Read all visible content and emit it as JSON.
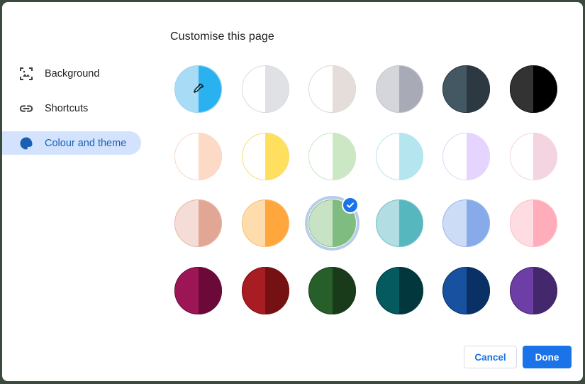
{
  "dialog": {
    "title": "Customise this page"
  },
  "nav": {
    "items": [
      {
        "label": "Background",
        "icon": "background-image-icon",
        "active": false
      },
      {
        "label": "Shortcuts",
        "icon": "link-icon",
        "active": false
      },
      {
        "label": "Colour and theme",
        "icon": "palette-icon",
        "active": true
      }
    ]
  },
  "swatches": [
    {
      "left": "#a8dcf6",
      "right": "#29b1f0",
      "border": "#9fd3ee",
      "icon": "eyedropper-icon",
      "selected": false
    },
    {
      "left": "#ffffff",
      "right": "#dfe1e5",
      "border": "#dadce0",
      "selected": false
    },
    {
      "left": "#ffffff",
      "right": "#e5ddda",
      "border": "#e0d9d6",
      "selected": false
    },
    {
      "left": "#d5d6dc",
      "right": "#a8aab6",
      "border": "#c6c8d0",
      "selected": false
    },
    {
      "left": "#445864",
      "right": "#2c3942",
      "border": "#2c3942",
      "selected": false
    },
    {
      "left": "#333333",
      "right": "#000000",
      "border": "#1a1a1a",
      "selected": false
    },
    {
      "left": "#ffffff",
      "right": "#fddac6",
      "border": "#f8d9c6",
      "selected": false
    },
    {
      "left": "#ffffff",
      "right": "#ffe05e",
      "border": "#f6de7e",
      "selected": false
    },
    {
      "left": "#ffffff",
      "right": "#cbe7c3",
      "border": "#cbe7c3",
      "selected": false
    },
    {
      "left": "#ffffff",
      "right": "#b5e6ef",
      "border": "#b5e6ef",
      "selected": false
    },
    {
      "left": "#ffffff",
      "right": "#e5d4fd",
      "border": "#e5d4fd",
      "selected": false
    },
    {
      "left": "#ffffff",
      "right": "#f4d4e1",
      "border": "#f4d4e1",
      "selected": false
    },
    {
      "left": "#f3ddd6",
      "right": "#e2a695",
      "border": "#e8b9aa",
      "selected": false
    },
    {
      "left": "#ffdcac",
      "right": "#ffa63c",
      "border": "#f8c07a",
      "selected": false
    },
    {
      "left": "#c7e2c5",
      "right": "#7fbc7f",
      "border": "#8fc08e",
      "selected": true
    },
    {
      "left": "#b1dde3",
      "right": "#57b7be",
      "border": "#7cc6cc",
      "selected": false
    },
    {
      "left": "#cddcf6",
      "right": "#87abe8",
      "border": "#9bb9ec",
      "selected": false
    },
    {
      "left": "#ffdbe2",
      "right": "#ffadbb",
      "border": "#ffc0cb",
      "selected": false
    },
    {
      "left": "#9c1655",
      "right": "#6b0a38",
      "border": "#6b0a38",
      "selected": false
    },
    {
      "left": "#a71d23",
      "right": "#751113",
      "border": "#751113",
      "selected": false
    },
    {
      "left": "#275f2b",
      "right": "#193b1a",
      "border": "#193b1a",
      "selected": false
    },
    {
      "left": "#045a5e",
      "right": "#02383d",
      "border": "#02383d",
      "selected": false
    },
    {
      "left": "#1751a0",
      "right": "#0a3166",
      "border": "#0a3166",
      "selected": false
    },
    {
      "left": "#6d3fa6",
      "right": "#45276d",
      "border": "#45276d",
      "selected": false
    }
  ],
  "footer": {
    "cancel_label": "Cancel",
    "done_label": "Done"
  },
  "colors": {
    "accent": "#1a73e8",
    "nav_active_bg": "#d3e3fd"
  }
}
